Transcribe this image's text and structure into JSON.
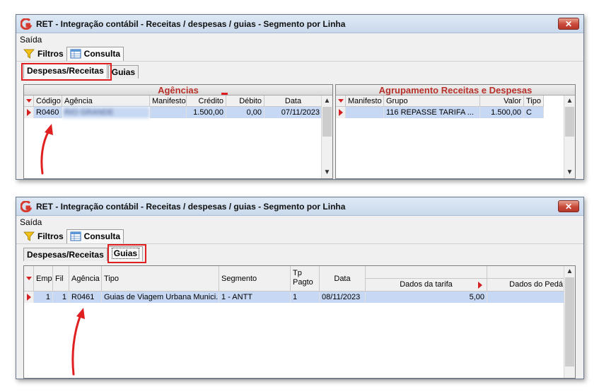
{
  "window1": {
    "title": "RET - Integração contábil - Receitas / despesas / guias - Segmento por Linha",
    "close_label": "✕",
    "menu": {
      "saida": "Saída"
    },
    "toolbar": {
      "filtros": "Filtros",
      "consulta": "Consulta"
    },
    "tabs": {
      "despesas_receitas": "Despesas/Receitas",
      "guias": "Guias"
    },
    "agencias": {
      "header": "Agências",
      "columns": [
        "Código",
        "Agência",
        "Manifesto",
        "Crédito",
        "Débito",
        "Data"
      ],
      "rows": [
        {
          "codigo": "R0460",
          "agencia": "RIO GRANDE",
          "manifesto": "",
          "credito": "1.500,00",
          "debito": "0,00",
          "data": "07/11/2023"
        }
      ]
    },
    "agrupamento": {
      "header": "Agrupamento Receitas e Despesas",
      "columns": [
        "Manifesto",
        "Grupo",
        "Valor",
        "Tipo"
      ],
      "rows": [
        {
          "manifesto": "",
          "grupo": "116 REPASSE TARIFA ...",
          "valor": "1.500,00",
          "tipo": "C"
        }
      ]
    }
  },
  "window2": {
    "title": "RET - Integração contábil - Receitas / despesas / guias - Segmento por Linha",
    "close_label": "✕",
    "menu": {
      "saida": "Saída"
    },
    "toolbar": {
      "filtros": "Filtros",
      "consulta": "Consulta"
    },
    "tabs": {
      "despesas_receitas": "Despesas/Receitas",
      "guias": "Guias"
    },
    "guias": {
      "columns": {
        "emp": "Emp",
        "fil": "Fil",
        "agencia": "Agência",
        "tipo": "Tipo",
        "segmento": "Segmento",
        "tp_pagto": "Tp Pagto",
        "data": "Data",
        "dados_tarifa": "Dados da tarifa",
        "dados_pedagio": "Dados do Pedá"
      },
      "rows": [
        {
          "emp": "1",
          "fil": "1",
          "agencia": "R0461",
          "tipo": "Guias de Viagem Urbana Munici...",
          "segmento": "1 - ANTT",
          "tp_pagto": "1",
          "data": "08/11/2023",
          "dados_tarifa": "5,00",
          "dados_pedagio": ""
        }
      ]
    }
  },
  "colors": {
    "accent_red": "#e02020",
    "selected_row": "#c6d8f3",
    "group_header_text": "#b8302a"
  }
}
